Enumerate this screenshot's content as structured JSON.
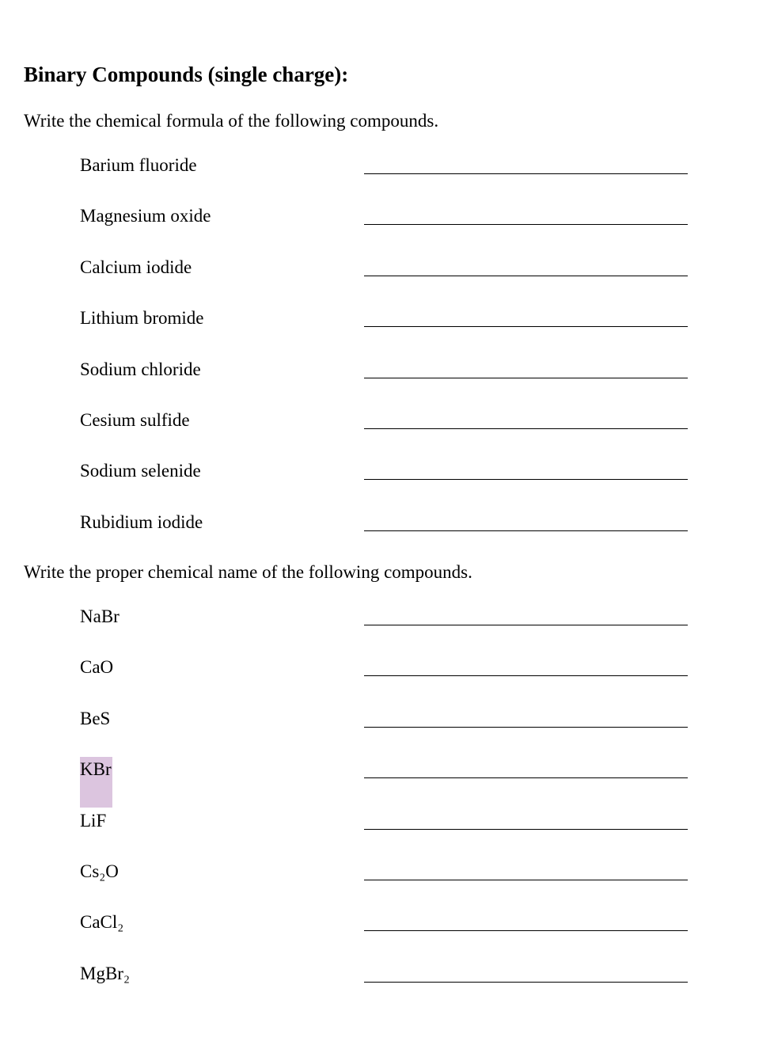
{
  "title": "Binary Compounds (single charge):",
  "sections": [
    {
      "instruction": "Write the chemical formula of the following compounds.",
      "items": [
        "Barium fluoride",
        "Magnesium oxide",
        "Calcium iodide",
        "Lithium bromide",
        "Sodium chloride",
        "Cesium sulfide",
        "Sodium selenide",
        "Rubidium iodide"
      ]
    },
    {
      "instruction": "Write the proper chemical name of the following compounds.",
      "items": [
        "NaBr",
        "CaO",
        "BeS",
        "KBr",
        "LiF",
        "Cs₂O",
        "CaCl₂",
        "MgBr₂"
      ],
      "highlighted_item": "KBr",
      "highlight_color": "#dcc5df"
    }
  ]
}
